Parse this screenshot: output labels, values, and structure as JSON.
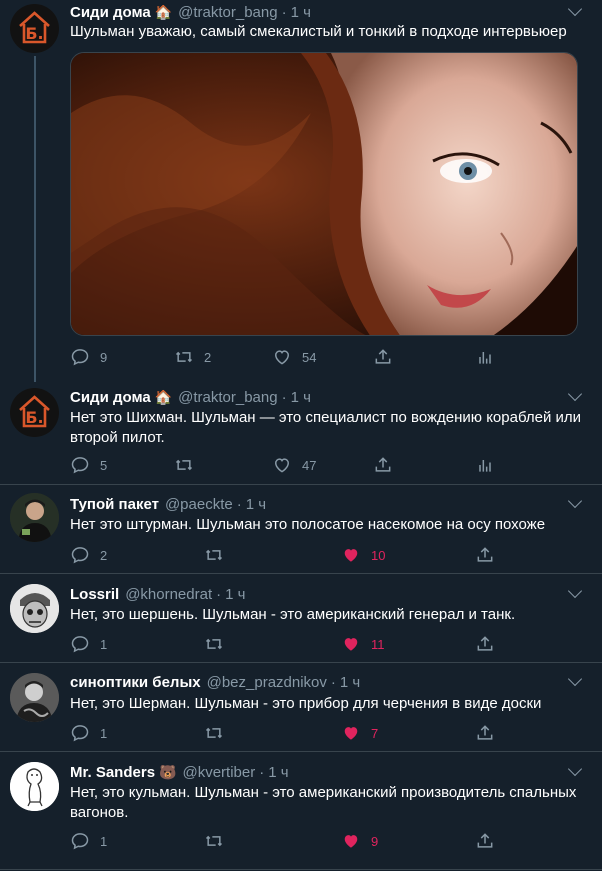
{
  "tweets": [
    {
      "name": "Сиди дома",
      "emoji": "🏠",
      "handle": "@traktor_bang",
      "time": "1 ч",
      "text": "Шульман уважаю, самый смекалистый и тонкий в подходе интервьюер",
      "replies": "9",
      "retweets": "2",
      "likes": "54",
      "liked": false
    },
    {
      "name": "Сиди дома",
      "emoji": "🏠",
      "handle": "@traktor_bang",
      "time": "1 ч",
      "text": "Нет это Шихман. Шульман — это специалист по вождению кораблей или второй пилот.",
      "replies": "5",
      "retweets": "",
      "likes": "47",
      "liked": false
    },
    {
      "name": "Тупой пакет",
      "emoji": "",
      "handle": "@paeckte",
      "time": "1 ч",
      "text": "Нет это штурман. Шульман это полосатое насекомое на осу похоже",
      "replies": "2",
      "retweets": "",
      "likes": "10",
      "liked": true
    },
    {
      "name": "Lossril",
      "emoji": "",
      "handle": "@khornedrat",
      "time": "1 ч",
      "text": "Нет, это шершень. Шульман - это американский генерал и танк.",
      "replies": "1",
      "retweets": "",
      "likes": "11",
      "liked": true
    },
    {
      "name": "синоптики белых",
      "emoji": "",
      "handle": "@bez_prazdnikov",
      "time": "1 ч",
      "text": "Нет, это Шерман. Шульман - это прибор для черчения в виде доски",
      "replies": "1",
      "retweets": "",
      "likes": "7",
      "liked": true
    },
    {
      "name": "Mr. Sanders",
      "emoji": "🐻",
      "handle": "@kvertiber",
      "time": "1 ч",
      "text": "Нет, это кульман. Шульман - это американский производитель спальных вагонов.",
      "replies": "1",
      "retweets": "",
      "likes": "9",
      "liked": true
    }
  ],
  "colors": {
    "background": "#15202b",
    "secondary_text": "#8899a6",
    "like_active": "#e0245e",
    "separator": "#38444d"
  }
}
